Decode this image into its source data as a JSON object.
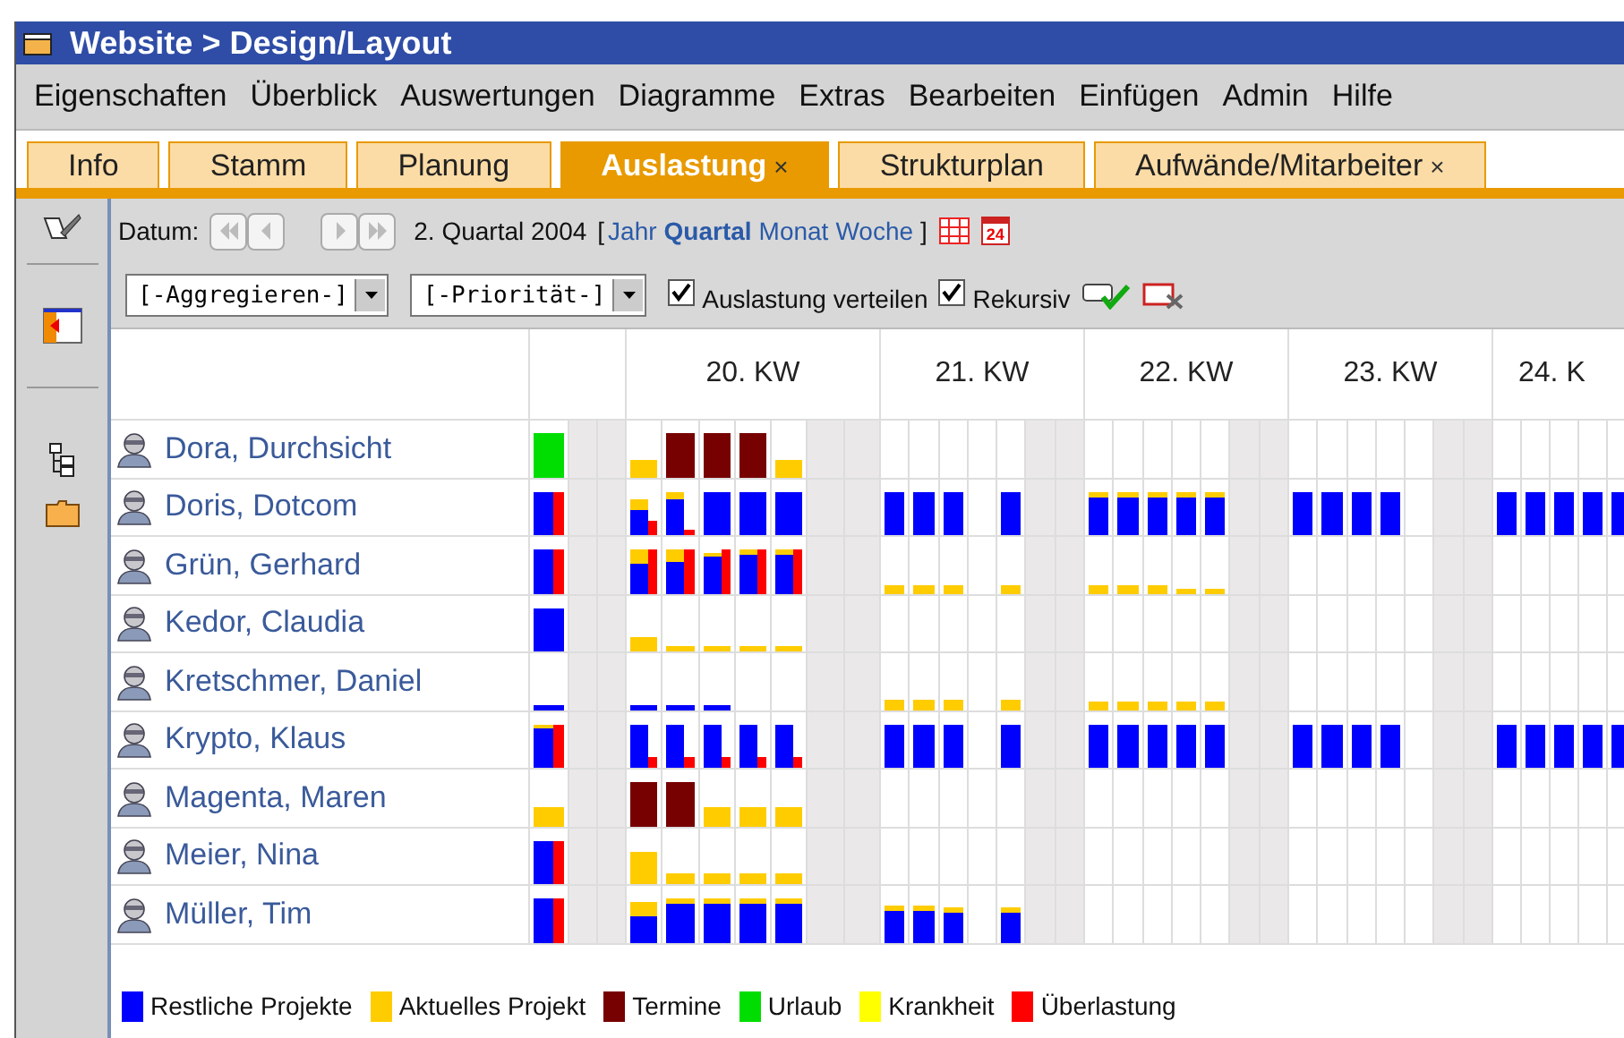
{
  "window": {
    "title": "Website > Design/Layout"
  },
  "menu": [
    "Eigenschaften",
    "Überblick",
    "Auswertungen",
    "Diagramme",
    "Extras",
    "Bearbeiten",
    "Einfügen",
    "Admin",
    "Hilfe"
  ],
  "tabs": [
    {
      "label": "Info",
      "selected": false
    },
    {
      "label": "Stamm",
      "selected": false
    },
    {
      "label": "Planung",
      "selected": false
    },
    {
      "label": "Auslastung",
      "selected": true,
      "close": "×"
    },
    {
      "label": "Strukturplan",
      "selected": false
    },
    {
      "label": "Aufwände/Mitarbeiter",
      "selected": false,
      "close": "×"
    }
  ],
  "toolbar": {
    "date_label": "Datum:",
    "period": "2. Quartal 2004",
    "open_bracket": "[",
    "close_bracket": "]",
    "calendar_day": "24",
    "periods": [
      {
        "label": "Jahr",
        "selected": false
      },
      {
        "label": "Quartal",
        "selected": true
      },
      {
        "label": "Monat",
        "selected": false
      },
      {
        "label": "Woche",
        "selected": false
      }
    ],
    "selects": [
      "[-Aggregieren-]",
      "[-Priorität-]"
    ],
    "checkboxes": [
      {
        "label": "Auslastung verteilen",
        "checked": true
      },
      {
        "label": "Rekursiv",
        "checked": true
      }
    ]
  },
  "weeks": [
    "20. KW",
    "21. KW",
    "22. KW",
    "23. KW",
    "24. K"
  ],
  "rows": [
    {
      "name": "Dora, Durchsicht",
      "summary": {
        "bars": [
          {
            "kind": "vacation",
            "level": 0.86
          }
        ]
      },
      "week_1": {
        "mon": {
          "bars": [
            {
              "kind": "current",
              "level": 0.34
            }
          ]
        },
        "tue": {
          "bars": [
            {
              "kind": "dates",
              "level": 0.86
            }
          ]
        },
        "wed": {
          "bars": [
            {
              "kind": "dates",
              "level": 0.86
            }
          ]
        },
        "thu": {
          "bars": [
            {
              "kind": "dates",
              "level": 0.86
            }
          ]
        },
        "fri": {
          "bars": [
            {
              "kind": "current",
              "level": 0.34
            }
          ]
        }
      }
    },
    {
      "name": "Doris, Dotcom",
      "summary": {
        "bars": [
          {
            "kind": "projects",
            "level": 0.86
          },
          {
            "kind": "overload",
            "level": 0.86
          }
        ]
      },
      "week_1": {
        "mon": {
          "bars": [
            {
              "kind": "projects",
              "level": 0.51
            },
            {
              "kind": "current",
              "level": 0.73
            },
            {
              "kind": "overload",
              "level": 0.3
            }
          ]
        },
        "tue": {
          "bars": [
            {
              "kind": "projects",
              "level": 0.73
            },
            {
              "kind": "current",
              "level": 0.86
            },
            {
              "kind": "overload",
              "level": 0.09
            }
          ]
        },
        "wed": {
          "bars": [
            {
              "kind": "projects",
              "level": 0.86
            }
          ]
        },
        "thu": {
          "bars": [
            {
              "kind": "projects",
              "level": 0.86
            }
          ]
        },
        "fri": {
          "bars": [
            {
              "kind": "projects",
              "level": 0.86
            }
          ]
        }
      },
      "week_2": {
        "mon": {
          "bars": [
            {
              "kind": "projects",
              "level": 0.86
            }
          ]
        },
        "tue": {
          "bars": [
            {
              "kind": "projects",
              "level": 0.86
            }
          ]
        },
        "wed": {
          "bars": [
            {
              "kind": "projects",
              "level": 0.86
            }
          ]
        },
        "fri": {
          "bars": [
            {
              "kind": "projects",
              "level": 0.86
            }
          ]
        }
      },
      "week_3": {
        "mon": {
          "bars": [
            {
              "kind": "projects",
              "level": 0.75
            },
            {
              "kind": "current",
              "level": 0.86
            }
          ]
        },
        "tue": {
          "bars": [
            {
              "kind": "projects",
              "level": 0.75
            },
            {
              "kind": "current",
              "level": 0.86
            }
          ]
        },
        "wed": {
          "bars": [
            {
              "kind": "projects",
              "level": 0.75
            },
            {
              "kind": "current",
              "level": 0.86
            }
          ]
        },
        "thu": {
          "bars": [
            {
              "kind": "projects",
              "level": 0.75
            },
            {
              "kind": "current",
              "level": 0.86
            }
          ]
        },
        "fri": {
          "bars": [
            {
              "kind": "projects",
              "level": 0.75
            },
            {
              "kind": "current",
              "level": 0.86
            }
          ]
        }
      },
      "week_4": {
        "mon": {
          "bars": [
            {
              "kind": "projects",
              "level": 0.86
            }
          ]
        },
        "tue": {
          "bars": [
            {
              "kind": "projects",
              "level": 0.86
            }
          ]
        },
        "wed": {
          "bars": [
            {
              "kind": "projects",
              "level": 0.86
            }
          ]
        },
        "thu": {
          "bars": [
            {
              "kind": "projects",
              "level": 0.86
            }
          ]
        }
      },
      "week_5": {
        "mon": {
          "bars": [
            {
              "kind": "projects",
              "level": 0.86
            }
          ]
        },
        "tue": {
          "bars": [
            {
              "kind": "projects",
              "level": 0.86
            }
          ]
        },
        "wed": {
          "bars": [
            {
              "kind": "projects",
              "level": 0.86
            }
          ]
        },
        "thu": {
          "bars": [
            {
              "kind": "projects",
              "level": 0.86
            }
          ]
        },
        "fri": {
          "bars": [
            {
              "kind": "projects",
              "level": 0.86
            }
          ]
        }
      }
    },
    {
      "name": "Grün, Gerhard",
      "summary": {
        "bars": [
          {
            "kind": "projects",
            "level": 0.86
          },
          {
            "kind": "overload",
            "level": 0.86
          }
        ]
      },
      "week_1": {
        "mon": {
          "bars": [
            {
              "kind": "projects",
              "level": 0.6
            },
            {
              "kind": "current",
              "level": 0.86
            },
            {
              "kind": "overload",
              "level": 0.86
            }
          ]
        },
        "tue": {
          "bars": [
            {
              "kind": "projects",
              "level": 0.64
            },
            {
              "kind": "current",
              "level": 0.86
            },
            {
              "kind": "overload",
              "level": 0.86
            }
          ]
        },
        "wed": {
          "bars": [
            {
              "kind": "projects",
              "level": 0.73
            },
            {
              "kind": "current",
              "level": 0.81
            },
            {
              "kind": "overload",
              "level": 0.86
            }
          ]
        },
        "thu": {
          "bars": [
            {
              "kind": "projects",
              "level": 0.77
            },
            {
              "kind": "current",
              "level": 0.86
            },
            {
              "kind": "overload",
              "level": 0.86
            }
          ]
        },
        "fri": {
          "bars": [
            {
              "kind": "projects",
              "level": 0.77
            },
            {
              "kind": "current",
              "level": 0.86
            },
            {
              "kind": "overload",
              "level": 0.86
            }
          ]
        }
      },
      "week_2": {
        "mon": {
          "bars": [
            {
              "kind": "current",
              "level": 0.17
            }
          ]
        },
        "tue": {
          "bars": [
            {
              "kind": "current",
              "level": 0.17
            }
          ]
        },
        "wed": {
          "bars": [
            {
              "kind": "current",
              "level": 0.17
            }
          ]
        },
        "fri": {
          "bars": [
            {
              "kind": "current",
              "level": 0.17
            }
          ]
        }
      },
      "week_3": {
        "mon": {
          "bars": [
            {
              "kind": "current",
              "level": 0.17
            }
          ]
        },
        "tue": {
          "bars": [
            {
              "kind": "current",
              "level": 0.17
            }
          ]
        },
        "wed": {
          "bars": [
            {
              "kind": "current",
              "level": 0.17
            }
          ]
        },
        "thu": {
          "bars": [
            {
              "kind": "current",
              "level": 0.09
            }
          ]
        },
        "fri": {
          "bars": [
            {
              "kind": "current",
              "level": 0.09
            }
          ]
        }
      }
    },
    {
      "name": "Kedor, Claudia",
      "summary": {
        "bars": [
          {
            "kind": "projects",
            "level": 0.86
          }
        ]
      },
      "week_1": {
        "mon": {
          "bars": [
            {
              "kind": "current",
              "level": 0.3
            }
          ]
        },
        "tue": {
          "bars": [
            {
              "kind": "current",
              "level": 0.09
            }
          ]
        },
        "wed": {
          "bars": [
            {
              "kind": "current",
              "level": 0.09
            }
          ]
        },
        "thu": {
          "bars": [
            {
              "kind": "current",
              "level": 0.09
            }
          ]
        },
        "fri": {
          "bars": [
            {
              "kind": "current",
              "level": 0.09
            }
          ]
        }
      }
    },
    {
      "name": "Kretschmer, Daniel",
      "summary": {
        "bars": [
          {
            "kind": "projects",
            "level": 0.09
          }
        ]
      },
      "week_1": {
        "mon": {
          "bars": [
            {
              "kind": "projects",
              "level": 0.09
            }
          ]
        },
        "tue": {
          "bars": [
            {
              "kind": "projects",
              "level": 0.09
            }
          ]
        },
        "wed": {
          "bars": [
            {
              "kind": "projects",
              "level": 0.09
            }
          ]
        }
      },
      "week_2": {
        "mon": {
          "bars": [
            {
              "kind": "current",
              "level": 0.21
            }
          ]
        },
        "tue": {
          "bars": [
            {
              "kind": "current",
              "level": 0.21
            }
          ]
        },
        "wed": {
          "bars": [
            {
              "kind": "current",
              "level": 0.21
            }
          ]
        },
        "fri": {
          "bars": [
            {
              "kind": "current",
              "level": 0.21
            }
          ]
        }
      },
      "week_3": {
        "mon": {
          "bars": [
            {
              "kind": "current",
              "level": 0.17
            }
          ]
        },
        "tue": {
          "bars": [
            {
              "kind": "current",
              "level": 0.17
            }
          ]
        },
        "wed": {
          "bars": [
            {
              "kind": "current",
              "level": 0.17
            }
          ]
        },
        "thu": {
          "bars": [
            {
              "kind": "current",
              "level": 0.17
            }
          ]
        },
        "fri": {
          "bars": [
            {
              "kind": "current",
              "level": 0.17
            }
          ]
        }
      }
    },
    {
      "name": "Krypto, Klaus",
      "summary": {
        "bars": [
          {
            "kind": "projects",
            "level": 0.77
          },
          {
            "kind": "current",
            "level": 0.86
          },
          {
            "kind": "overload",
            "level": 0.86
          }
        ]
      },
      "week_1": {
        "mon": {
          "bars": [
            {
              "kind": "projects",
              "level": 0.86
            },
            {
              "kind": "overload",
              "level": 0.21
            }
          ]
        },
        "tue": {
          "bars": [
            {
              "kind": "projects",
              "level": 0.86
            },
            {
              "kind": "overload",
              "level": 0.21
            }
          ]
        },
        "wed": {
          "bars": [
            {
              "kind": "projects",
              "level": 0.86
            },
            {
              "kind": "overload",
              "level": 0.21
            }
          ]
        },
        "thu": {
          "bars": [
            {
              "kind": "projects",
              "level": 0.86
            },
            {
              "kind": "overload",
              "level": 0.21
            }
          ]
        },
        "fri": {
          "bars": [
            {
              "kind": "projects",
              "level": 0.86
            },
            {
              "kind": "overload",
              "level": 0.21
            }
          ]
        }
      },
      "week_2": {
        "mon": {
          "bars": [
            {
              "kind": "projects",
              "level": 0.86
            }
          ]
        },
        "tue": {
          "bars": [
            {
              "kind": "projects",
              "level": 0.86
            }
          ]
        },
        "wed": {
          "bars": [
            {
              "kind": "projects",
              "level": 0.86
            }
          ]
        },
        "fri": {
          "bars": [
            {
              "kind": "projects",
              "level": 0.86
            }
          ]
        }
      },
      "week_3": {
        "mon": {
          "bars": [
            {
              "kind": "projects",
              "level": 0.86
            }
          ]
        },
        "tue": {
          "bars": [
            {
              "kind": "projects",
              "level": 0.86
            }
          ]
        },
        "wed": {
          "bars": [
            {
              "kind": "projects",
              "level": 0.86
            }
          ]
        },
        "thu": {
          "bars": [
            {
              "kind": "projects",
              "level": 0.86
            }
          ]
        },
        "fri": {
          "bars": [
            {
              "kind": "projects",
              "level": 0.86
            }
          ]
        }
      },
      "week_4": {
        "mon": {
          "bars": [
            {
              "kind": "projects",
              "level": 0.86
            }
          ]
        },
        "tue": {
          "bars": [
            {
              "kind": "projects",
              "level": 0.86
            }
          ]
        },
        "wed": {
          "bars": [
            {
              "kind": "projects",
              "level": 0.86
            }
          ]
        },
        "thu": {
          "bars": [
            {
              "kind": "projects",
              "level": 0.86
            }
          ]
        }
      },
      "week_5": {
        "mon": {
          "bars": [
            {
              "kind": "projects",
              "level": 0.86
            }
          ]
        },
        "tue": {
          "bars": [
            {
              "kind": "projects",
              "level": 0.86
            }
          ]
        },
        "wed": {
          "bars": [
            {
              "kind": "projects",
              "level": 0.86
            }
          ]
        },
        "thu": {
          "bars": [
            {
              "kind": "projects",
              "level": 0.86
            }
          ]
        },
        "fri": {
          "bars": [
            {
              "kind": "projects",
              "level": 0.86
            }
          ]
        }
      }
    },
    {
      "name": "Magenta, Maren",
      "summary": {
        "bars": [
          {
            "kind": "current",
            "level": 0.39
          }
        ]
      },
      "week_1": {
        "mon": {
          "bars": [
            {
              "kind": "dates",
              "level": 0.86
            }
          ]
        },
        "tue": {
          "bars": [
            {
              "kind": "dates",
              "level": 0.86
            }
          ]
        },
        "wed": {
          "bars": [
            {
              "kind": "current",
              "level": 0.39
            }
          ]
        },
        "thu": {
          "bars": [
            {
              "kind": "current",
              "level": 0.39
            }
          ]
        },
        "fri": {
          "bars": [
            {
              "kind": "current",
              "level": 0.39
            }
          ]
        }
      }
    },
    {
      "name": "Meier, Nina",
      "summary": {
        "bars": [
          {
            "kind": "projects",
            "level": 0.86
          },
          {
            "kind": "overload",
            "level": 0.86
          }
        ]
      },
      "week_1": {
        "mon": {
          "bars": [
            {
              "kind": "current",
              "level": 0.64
            }
          ]
        },
        "tue": {
          "bars": [
            {
              "kind": "current",
              "level": 0.21
            }
          ]
        },
        "wed": {
          "bars": [
            {
              "kind": "current",
              "level": 0.21
            }
          ]
        },
        "thu": {
          "bars": [
            {
              "kind": "current",
              "level": 0.21
            }
          ]
        },
        "fri": {
          "bars": [
            {
              "kind": "current",
              "level": 0.21
            }
          ]
        }
      }
    },
    {
      "name": "Müller, Tim",
      "summary": {
        "bars": [
          {
            "kind": "projects",
            "level": 0.86
          },
          {
            "kind": "overload",
            "level": 0.86
          }
        ]
      },
      "week_1": {
        "mon": {
          "bars": [
            {
              "kind": "projects",
              "level": 0.51
            },
            {
              "kind": "current",
              "level": 0.81
            }
          ]
        },
        "tue": {
          "bars": [
            {
              "kind": "projects",
              "level": 0.77
            },
            {
              "kind": "current",
              "level": 0.86
            }
          ]
        },
        "wed": {
          "bars": [
            {
              "kind": "projects",
              "level": 0.77
            },
            {
              "kind": "current",
              "level": 0.86
            }
          ]
        },
        "thu": {
          "bars": [
            {
              "kind": "projects",
              "level": 0.77
            },
            {
              "kind": "current",
              "level": 0.86
            }
          ]
        },
        "fri": {
          "bars": [
            {
              "kind": "projects",
              "level": 0.77
            },
            {
              "kind": "current",
              "level": 0.86
            }
          ]
        }
      },
      "week_2": {
        "mon": {
          "bars": [
            {
              "kind": "projects",
              "level": 0.64
            },
            {
              "kind": "current",
              "level": 0.73
            }
          ]
        },
        "tue": {
          "bars": [
            {
              "kind": "projects",
              "level": 0.64
            },
            {
              "kind": "current",
              "level": 0.73
            }
          ]
        },
        "wed": {
          "bars": [
            {
              "kind": "projects",
              "level": 0.6
            },
            {
              "kind": "current",
              "level": 0.69
            }
          ]
        },
        "fri": {
          "bars": [
            {
              "kind": "projects",
              "level": 0.6
            },
            {
              "kind": "current",
              "level": 0.69
            }
          ]
        }
      }
    }
  ],
  "legend": [
    {
      "kind": "projects",
      "label": "Restliche Projekte",
      "color": "#0000ff"
    },
    {
      "kind": "current",
      "label": "Aktuelles Projekt",
      "color": "#ffcc00"
    },
    {
      "kind": "dates",
      "label": "Termine",
      "color": "#770000"
    },
    {
      "kind": "vacation",
      "label": "Urlaub",
      "color": "#00dd00"
    },
    {
      "kind": "sick",
      "label": "Krankheit",
      "color": "#ffff00"
    },
    {
      "kind": "overload",
      "label": "Überlastung",
      "color": "#ff0000"
    }
  ]
}
